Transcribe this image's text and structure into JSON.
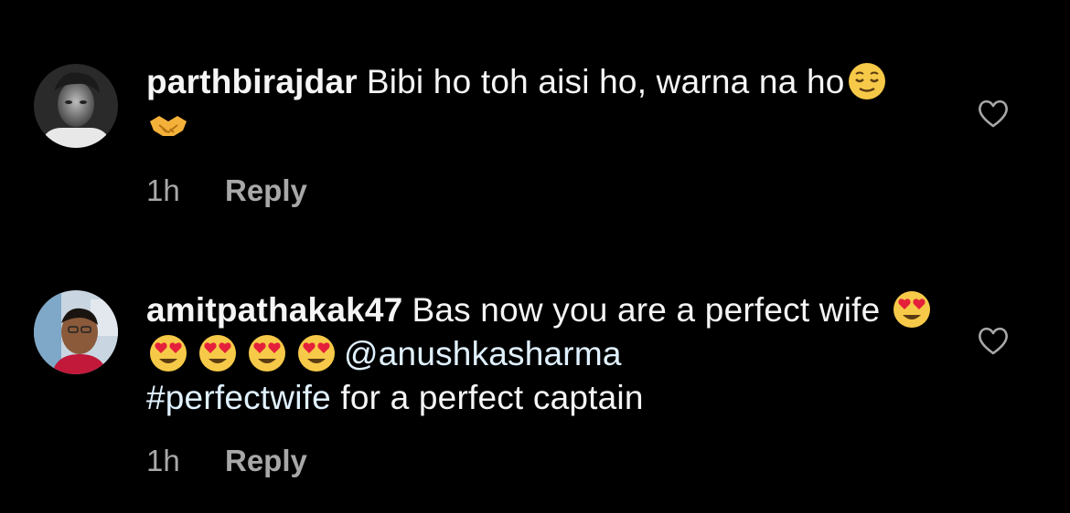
{
  "comments": [
    {
      "username": "parthbirajdar",
      "text_parts": [
        "Bibi ho toh aisi ho, warna na ho"
      ],
      "emoji_icons": [
        "relieved-face-emoji",
        "handshake-emoji"
      ],
      "time": "1h",
      "reply_label": "Reply"
    },
    {
      "username": "amitpathakak47",
      "text_parts": [
        "Bas now you are a perfect wife ",
        "@anushkasharma",
        "#perfectwife",
        " for a perfect captain"
      ],
      "emoji_icons": [
        "heart-eyes-emoji",
        "heart-eyes-emoji",
        "heart-eyes-emoji",
        "heart-eyes-emoji",
        "heart-eyes-emoji"
      ],
      "time": "1h",
      "reply_label": "Reply"
    }
  ],
  "colors": {
    "background": "#000000",
    "text": "#f5f5f5",
    "muted": "#a8a8a8",
    "link": "#e0f1ff"
  },
  "icons": [
    "heart-outline-icon"
  ]
}
